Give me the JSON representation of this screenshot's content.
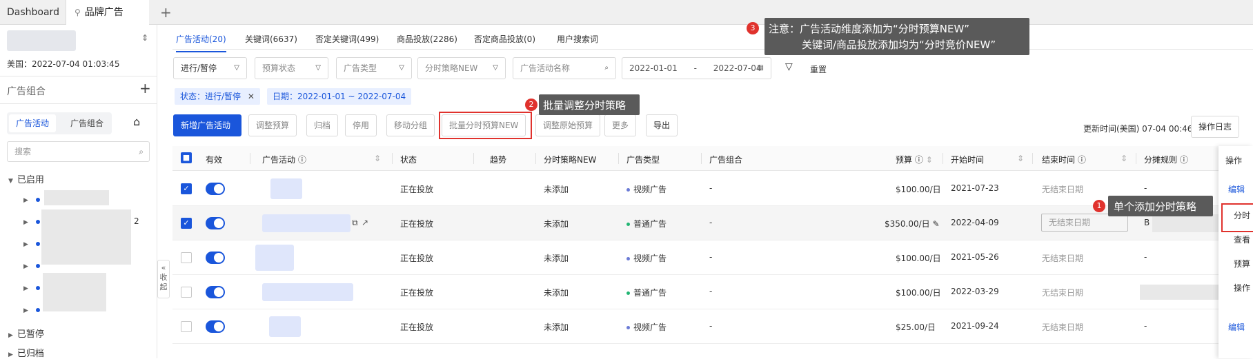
{
  "tabs": {
    "dashboard": "Dashboard",
    "brand_ads": "品牌广告"
  },
  "sidebar": {
    "time": "美国：2022-07-04 01:03:45",
    "section_title": "广告组合",
    "seg_campaign": "广告活动",
    "seg_portfolio": "广告组合",
    "search_placeholder": "搜索",
    "tree_enabled": "已启用",
    "tree_paused": "已暂停",
    "tree_archived": "已归档",
    "tree_partial": "2",
    "collapse": "收起"
  },
  "subtabs": [
    "广告活动(20)",
    "关键词(6637)",
    "否定关键词(499)",
    "商品投放(2286)",
    "否定商品投放(0)",
    "用户搜索词"
  ],
  "filters": {
    "status": "进行/暂停",
    "budget_status": "预算状态",
    "ad_type": "广告类型",
    "strategy": "分时策略NEW",
    "name_placeholder": "广告活动名称",
    "date_from": "2022-01-01",
    "date_sep": "-",
    "date_to": "2022-07-04",
    "reset": "重置"
  },
  "tags": [
    "状态：进行/暂停",
    "日期：2022-01-01 ~ 2022-07-04"
  ],
  "toolbar": {
    "new_campaign": "新增广告活动",
    "adjust_budget": "调整预算",
    "archive": "归档",
    "disable": "停用",
    "move_group": "移动分组",
    "batch_budget": "批量分时预算NEW",
    "adjust_original": "调整原始预算",
    "more": "更多",
    "export": "导出",
    "update_time": "更新时间(美国) 07-04 00:46",
    "op_log": "操作日志"
  },
  "columns": {
    "valid": "有效",
    "campaign": "广告活动",
    "status": "状态",
    "trend": "趋势",
    "strategy": "分时策略NEW",
    "ad_type": "广告类型",
    "portfolio": "广告组合",
    "budget": "预算",
    "start": "开始时间",
    "end": "结束时间",
    "rule": "分摊规则",
    "ops": "操作"
  },
  "rows": [
    {
      "status": "正在投放",
      "strategy": "未添加",
      "type": "视频广告",
      "type_color": "#6b7bd6",
      "portfolio": "-",
      "budget": "$100.00/日",
      "start": "2021-07-23",
      "end": "无结束日期",
      "rule": "-"
    },
    {
      "status": "正在投放",
      "strategy": "未添加",
      "type": "普通广告",
      "type_color": "#22b573",
      "portfolio": "-",
      "budget": "$350.00/日",
      "start": "2022-04-09",
      "end": "无结束日期",
      "rule": "B"
    },
    {
      "status": "正在投放",
      "strategy": "未添加",
      "type": "视频广告",
      "type_color": "#6b7bd6",
      "portfolio": "-",
      "budget": "$100.00/日",
      "start": "2021-05-26",
      "end": "无结束日期",
      "rule": "-"
    },
    {
      "status": "正在投放",
      "strategy": "未添加",
      "type": "普通广告",
      "type_color": "#22b573",
      "portfolio": "-",
      "budget": "$100.00/日",
      "start": "2022-03-29",
      "end": "无结束日期",
      "rule": ""
    },
    {
      "status": "正在投放",
      "strategy": "未添加",
      "type": "视频广告",
      "type_color": "#6b7bd6",
      "portfolio": "-",
      "budget": "$25.00/日",
      "start": "2021-09-24",
      "end": "无结束日期",
      "rule": "-"
    }
  ],
  "ops": {
    "edit": "编辑",
    "time": "分时",
    "view": "查看",
    "budget": "预算",
    "op": "操作"
  },
  "tips": {
    "t1": "单个添加分时策略",
    "t2": "批量调整分时策略",
    "t3_line1": "注意：广告活动维度添加为“分时预算NEW”",
    "t3_line2": "关键词/商品投放添加均为“分时竞价NEW”",
    "n1": "1",
    "n2": "2",
    "n3": "3"
  }
}
